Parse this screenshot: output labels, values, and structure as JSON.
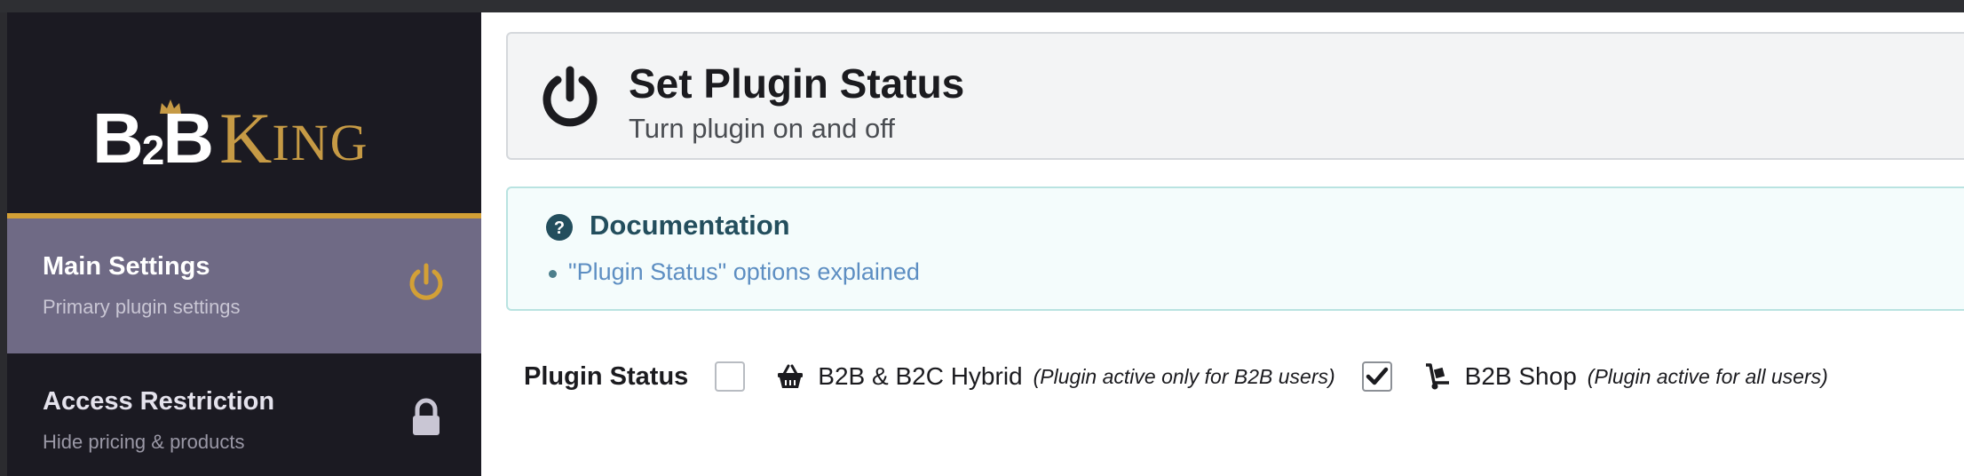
{
  "sidebar": {
    "logo": {
      "part1": "B",
      "part2": "2",
      "part3": "B",
      "part4": "K",
      "part5": "ING"
    },
    "items": [
      {
        "title": "Main Settings",
        "subtitle": "Primary plugin settings",
        "icon": "power-icon",
        "active": true
      },
      {
        "title": "Access Restriction",
        "subtitle": "Hide pricing & products",
        "icon": "lock-icon",
        "active": false
      }
    ]
  },
  "header": {
    "title": "Set Plugin Status",
    "subtitle": "Turn plugin on and off",
    "icon": "power-icon"
  },
  "documentation": {
    "title": "Documentation",
    "icon": "question-circle-icon",
    "link": "\"Plugin Status\" options explained"
  },
  "plugin_status": {
    "label": "Plugin Status",
    "options": [
      {
        "label": "B2B & B2C Hybrid",
        "note": "(Plugin active only for B2B users)",
        "checked": false,
        "icon": "basket-icon"
      },
      {
        "label": "B2B Shop",
        "note": "(Plugin active for all users)",
        "checked": true,
        "icon": "dolly-cart-icon"
      }
    ]
  },
  "colors": {
    "sidebar_bg": "#1b1a22",
    "active_item_bg": "#6f6a85",
    "accent_gold": "#d3a036",
    "doc_title": "#234e5d",
    "doc_link": "#5d8ec2"
  }
}
